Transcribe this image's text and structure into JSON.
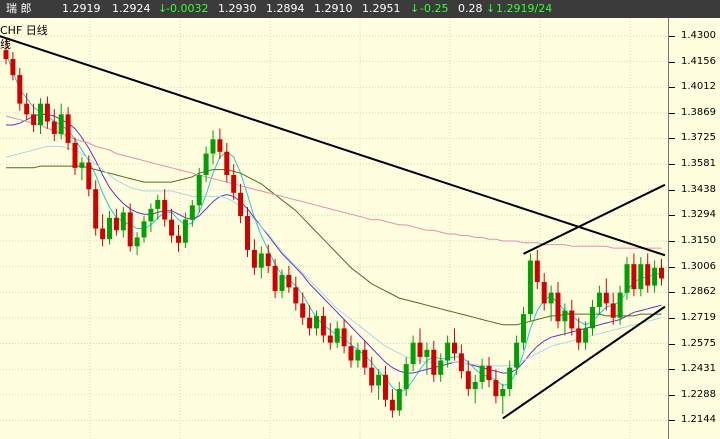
{
  "header": {
    "symbol": "瑞  郎",
    "last": "1.2919",
    "ask": "1.2924",
    "change": "-0.0032",
    "open": "1.2930",
    "low": "1.2894",
    "prev": "1.2910",
    "high": "1.2951",
    "change_pct": "-0.25",
    "amplitude": "0.28",
    "bid_info": "1.2919/24"
  },
  "labels": {
    "line1": "CHF  日线",
    "line2": "线"
  },
  "colors": {
    "bg": "#FFFFE0",
    "candle_up": "#00A000",
    "candle_down": "#D00000",
    "grid": "#D8D8B8",
    "ma_cyan": "#22C6DD",
    "ma_purple": "#6A2CC8",
    "ma_olive": "#4F6B1E",
    "ma_pink": "#E58BB8",
    "ma_lightblue": "#A8D8E8",
    "trend": "#000000"
  },
  "chart_data": {
    "type": "candlestick",
    "title": "",
    "ylim": [
      1.204,
      1.44
    ],
    "y_ticks": [
      "1.4300",
      "1.4156",
      "1.4012",
      "1.3869",
      "1.3725",
      "1.3581",
      "1.3438",
      "1.3294",
      "1.3150",
      "1.3006",
      "1.2862",
      "1.2719",
      "1.2575",
      "1.2431",
      "1.2288",
      "1.2144"
    ],
    "candles": [
      [
        1.422,
        1.428,
        1.414,
        1.417
      ],
      [
        1.417,
        1.421,
        1.405,
        1.408
      ],
      [
        1.408,
        1.412,
        1.388,
        1.392
      ],
      [
        1.392,
        1.398,
        1.383,
        1.386
      ],
      [
        1.386,
        1.392,
        1.376,
        1.38
      ],
      [
        1.38,
        1.395,
        1.375,
        1.392
      ],
      [
        1.392,
        1.396,
        1.378,
        1.382
      ],
      [
        1.382,
        1.389,
        1.371,
        1.375
      ],
      [
        1.375,
        1.392,
        1.372,
        1.386
      ],
      [
        1.386,
        1.39,
        1.366,
        1.37
      ],
      [
        1.37,
        1.373,
        1.352,
        1.356
      ],
      [
        1.356,
        1.362,
        1.349,
        1.359
      ],
      [
        1.359,
        1.363,
        1.34,
        1.344
      ],
      [
        1.344,
        1.349,
        1.318,
        1.322
      ],
      [
        1.322,
        1.33,
        1.312,
        1.316
      ],
      [
        1.316,
        1.332,
        1.313,
        1.328
      ],
      [
        1.328,
        1.333,
        1.318,
        1.321
      ],
      [
        1.321,
        1.334,
        1.317,
        1.331
      ],
      [
        1.331,
        1.336,
        1.309,
        1.312
      ],
      [
        1.312,
        1.32,
        1.307,
        1.317
      ],
      [
        1.317,
        1.329,
        1.314,
        1.326
      ],
      [
        1.326,
        1.336,
        1.32,
        1.333
      ],
      [
        1.333,
        1.341,
        1.327,
        1.338
      ],
      [
        1.338,
        1.344,
        1.323,
        1.327
      ],
      [
        1.327,
        1.333,
        1.314,
        1.318
      ],
      [
        1.318,
        1.324,
        1.309,
        1.314
      ],
      [
        1.314,
        1.331,
        1.311,
        1.327
      ],
      [
        1.327,
        1.338,
        1.323,
        1.335
      ],
      [
        1.335,
        1.356,
        1.331,
        1.352
      ],
      [
        1.352,
        1.368,
        1.348,
        1.364
      ],
      [
        1.364,
        1.377,
        1.358,
        1.372
      ],
      [
        1.372,
        1.378,
        1.361,
        1.365
      ],
      [
        1.365,
        1.37,
        1.348,
        1.352
      ],
      [
        1.352,
        1.358,
        1.338,
        1.342
      ],
      [
        1.342,
        1.347,
        1.325,
        1.329
      ],
      [
        1.329,
        1.334,
        1.306,
        1.31
      ],
      [
        1.31,
        1.316,
        1.296,
        1.3
      ],
      [
        1.3,
        1.312,
        1.294,
        1.308
      ],
      [
        1.308,
        1.313,
        1.297,
        1.301
      ],
      [
        1.301,
        1.305,
        1.283,
        1.287
      ],
      [
        1.287,
        1.299,
        1.283,
        1.296
      ],
      [
        1.296,
        1.301,
        1.286,
        1.289
      ],
      [
        1.289,
        1.295,
        1.276,
        1.28
      ],
      [
        1.28,
        1.286,
        1.268,
        1.272
      ],
      [
        1.272,
        1.279,
        1.262,
        1.266
      ],
      [
        1.266,
        1.276,
        1.262,
        1.273
      ],
      [
        1.273,
        1.278,
        1.258,
        1.262
      ],
      [
        1.262,
        1.269,
        1.254,
        1.258
      ],
      [
        1.258,
        1.27,
        1.255,
        1.266
      ],
      [
        1.266,
        1.271,
        1.252,
        1.256
      ],
      [
        1.256,
        1.262,
        1.244,
        1.248
      ],
      [
        1.248,
        1.258,
        1.244,
        1.254
      ],
      [
        1.254,
        1.259,
        1.24,
        1.244
      ],
      [
        1.244,
        1.25,
        1.23,
        1.234
      ],
      [
        1.234,
        1.243,
        1.226,
        1.24
      ],
      [
        1.24,
        1.245,
        1.222,
        1.226
      ],
      [
        1.226,
        1.232,
        1.216,
        1.22
      ],
      [
        1.22,
        1.236,
        1.217,
        1.232
      ],
      [
        1.232,
        1.25,
        1.228,
        1.246
      ],
      [
        1.246,
        1.262,
        1.242,
        1.258
      ],
      [
        1.258,
        1.266,
        1.246,
        1.25
      ],
      [
        1.25,
        1.258,
        1.24,
        1.254
      ],
      [
        1.254,
        1.259,
        1.236,
        1.24
      ],
      [
        1.24,
        1.252,
        1.236,
        1.248
      ],
      [
        1.248,
        1.262,
        1.244,
        1.258
      ],
      [
        1.258,
        1.266,
        1.248,
        1.252
      ],
      [
        1.252,
        1.257,
        1.238,
        1.242
      ],
      [
        1.242,
        1.248,
        1.228,
        1.232
      ],
      [
        1.232,
        1.24,
        1.224,
        1.236
      ],
      [
        1.236,
        1.249,
        1.232,
        1.245
      ],
      [
        1.245,
        1.25,
        1.233,
        1.237
      ],
      [
        1.237,
        1.243,
        1.224,
        1.228
      ],
      [
        1.228,
        1.235,
        1.218,
        1.232
      ],
      [
        1.232,
        1.248,
        1.228,
        1.244
      ],
      [
        1.244,
        1.262,
        1.24,
        1.258
      ],
      [
        1.258,
        1.278,
        1.254,
        1.274
      ],
      [
        1.274,
        1.308,
        1.27,
        1.304
      ],
      [
        1.304,
        1.31,
        1.288,
        1.292
      ],
      [
        1.292,
        1.297,
        1.276,
        1.28
      ],
      [
        1.28,
        1.29,
        1.27,
        1.286
      ],
      [
        1.286,
        1.292,
        1.266,
        1.27
      ],
      [
        1.27,
        1.28,
        1.262,
        1.276
      ],
      [
        1.276,
        1.282,
        1.262,
        1.266
      ],
      [
        1.266,
        1.272,
        1.254,
        1.258
      ],
      [
        1.258,
        1.27,
        1.254,
        1.266
      ],
      [
        1.266,
        1.282,
        1.262,
        1.278
      ],
      [
        1.278,
        1.29,
        1.274,
        1.286
      ],
      [
        1.286,
        1.294,
        1.276,
        1.28
      ],
      [
        1.28,
        1.286,
        1.268,
        1.272
      ],
      [
        1.272,
        1.29,
        1.268,
        1.286
      ],
      [
        1.286,
        1.306,
        1.282,
        1.302
      ],
      [
        1.302,
        1.308,
        1.284,
        1.288
      ],
      [
        1.288,
        1.306,
        1.284,
        1.302
      ],
      [
        1.302,
        1.308,
        1.286,
        1.29
      ],
      [
        1.29,
        1.304,
        1.286,
        1.3
      ],
      [
        1.3,
        1.305,
        1.29,
        1.294
      ]
    ],
    "ma_series": [
      {
        "color_key": "ma_cyan",
        "values": [
          1.42,
          1.41,
          1.4,
          1.395,
          1.39,
          1.387,
          1.385,
          1.382,
          1.38,
          1.377,
          1.372,
          1.366,
          1.36,
          1.352,
          1.342,
          1.334,
          1.328,
          1.326,
          1.324,
          1.322,
          1.322,
          1.324,
          1.328,
          1.331,
          1.331,
          1.327,
          1.324,
          1.325,
          1.331,
          1.341,
          1.353,
          1.362,
          1.365,
          1.362,
          1.353,
          1.341,
          1.328,
          1.318,
          1.31,
          1.302,
          1.296,
          1.293,
          1.29,
          1.285,
          1.278,
          1.272,
          1.268,
          1.265,
          1.262,
          1.26,
          1.257,
          1.254,
          1.251,
          1.247,
          1.242,
          1.238,
          1.233,
          1.23,
          1.232,
          1.237,
          1.243,
          1.248,
          1.25,
          1.249,
          1.249,
          1.25,
          1.25,
          1.247,
          1.243,
          1.24,
          1.239,
          1.237,
          1.234,
          1.235,
          1.242,
          1.252,
          1.266,
          1.276,
          1.282,
          1.284,
          1.28,
          1.276,
          1.273,
          1.27,
          1.268,
          1.27,
          1.274,
          1.278,
          1.279,
          1.281,
          1.287,
          1.292,
          1.294,
          1.295,
          1.296,
          1.297
        ]
      },
      {
        "color_key": "ma_purple",
        "values": [
          1.38,
          1.38,
          1.381,
          1.383,
          1.385,
          1.386,
          1.386,
          1.385,
          1.383,
          1.381,
          1.378,
          1.373,
          1.367,
          1.36,
          1.352,
          1.345,
          1.34,
          1.336,
          1.333,
          1.331,
          1.33,
          1.33,
          1.331,
          1.332,
          1.332,
          1.33,
          1.328,
          1.327,
          1.329,
          1.333,
          1.337,
          1.34,
          1.341,
          1.34,
          1.337,
          1.333,
          1.328,
          1.323,
          1.318,
          1.313,
          1.308,
          1.304,
          1.3,
          1.296,
          1.291,
          1.287,
          1.283,
          1.279,
          1.275,
          1.271,
          1.267,
          1.263,
          1.259,
          1.255,
          1.251,
          1.247,
          1.244,
          1.242,
          1.241,
          1.241,
          1.242,
          1.243,
          1.244,
          1.245,
          1.246,
          1.247,
          1.247,
          1.246,
          1.245,
          1.244,
          1.243,
          1.242,
          1.241,
          1.241,
          1.243,
          1.247,
          1.252,
          1.256,
          1.259,
          1.261,
          1.262,
          1.263,
          1.264,
          1.265,
          1.266,
          1.267,
          1.268,
          1.269,
          1.27,
          1.271,
          1.273,
          1.275,
          1.276,
          1.277,
          1.278,
          1.279
        ]
      },
      {
        "color_key": "ma_olive",
        "values": [
          1.356,
          1.356,
          1.356,
          1.356,
          1.356,
          1.357,
          1.357,
          1.357,
          1.357,
          1.357,
          1.357,
          1.357,
          1.356,
          1.355,
          1.354,
          1.353,
          1.352,
          1.351,
          1.35,
          1.349,
          1.348,
          1.348,
          1.348,
          1.348,
          1.348,
          1.349,
          1.35,
          1.351,
          1.353,
          1.354,
          1.355,
          1.355,
          1.355,
          1.354,
          1.353,
          1.351,
          1.349,
          1.347,
          1.344,
          1.341,
          1.338,
          1.335,
          1.332,
          1.328,
          1.324,
          1.32,
          1.316,
          1.312,
          1.308,
          1.304,
          1.3,
          1.297,
          1.294,
          1.291,
          1.289,
          1.287,
          1.285,
          1.283,
          1.282,
          1.281,
          1.28,
          1.279,
          1.278,
          1.277,
          1.276,
          1.275,
          1.274,
          1.273,
          1.272,
          1.271,
          1.27,
          1.269,
          1.268,
          1.268,
          1.268,
          1.269,
          1.27,
          1.271,
          1.272,
          1.273,
          1.273,
          1.274,
          1.274,
          1.274,
          1.274,
          1.274,
          1.274,
          1.273,
          1.273,
          1.273,
          1.273,
          1.273,
          1.274,
          1.274,
          1.274,
          1.274
        ]
      },
      {
        "color_key": "ma_pink",
        "values": [
          1.385,
          1.384,
          1.383,
          1.382,
          1.381,
          1.38,
          1.378,
          1.377,
          1.375,
          1.374,
          1.372,
          1.371,
          1.37,
          1.368,
          1.367,
          1.366,
          1.364,
          1.363,
          1.362,
          1.361,
          1.36,
          1.359,
          1.358,
          1.357,
          1.356,
          1.355,
          1.354,
          1.353,
          1.352,
          1.351,
          1.35,
          1.349,
          1.348,
          1.347,
          1.346,
          1.345,
          1.344,
          1.343,
          1.342,
          1.341,
          1.34,
          1.339,
          1.338,
          1.337,
          1.336,
          1.335,
          1.334,
          1.333,
          1.332,
          1.331,
          1.33,
          1.329,
          1.328,
          1.327,
          1.327,
          1.326,
          1.325,
          1.324,
          1.324,
          1.323,
          1.322,
          1.321,
          1.321,
          1.32,
          1.319,
          1.319,
          1.318,
          1.318,
          1.317,
          1.317,
          1.316,
          1.316,
          1.315,
          1.315,
          1.315,
          1.314,
          1.314,
          1.314,
          1.313,
          1.313,
          1.313,
          1.313,
          1.312,
          1.312,
          1.312,
          1.312,
          1.312,
          1.312,
          1.311,
          1.311,
          1.311,
          1.311,
          1.311,
          1.311,
          1.311,
          1.311
        ]
      },
      {
        "color_key": "ma_lightblue",
        "values": [
          1.362,
          1.363,
          1.364,
          1.365,
          1.366,
          1.367,
          1.368,
          1.368,
          1.368,
          1.367,
          1.366,
          1.364,
          1.361,
          1.358,
          1.355,
          1.352,
          1.349,
          1.347,
          1.345,
          1.344,
          1.343,
          1.343,
          1.343,
          1.343,
          1.343,
          1.342,
          1.341,
          1.34,
          1.34,
          1.34,
          1.34,
          1.34,
          1.339,
          1.337,
          1.334,
          1.331,
          1.327,
          1.323,
          1.319,
          1.314,
          1.309,
          1.305,
          1.301,
          1.297,
          1.293,
          1.289,
          1.285,
          1.281,
          1.277,
          1.274,
          1.271,
          1.268,
          1.265,
          1.262,
          1.259,
          1.256,
          1.254,
          1.252,
          1.25,
          1.249,
          1.248,
          1.247,
          1.247,
          1.247,
          1.247,
          1.247,
          1.247,
          1.246,
          1.246,
          1.245,
          1.245,
          1.245,
          1.245,
          1.245,
          1.246,
          1.248,
          1.25,
          1.252,
          1.254,
          1.256,
          1.257,
          1.258,
          1.259,
          1.26,
          1.261,
          1.262,
          1.263,
          1.264,
          1.265,
          1.266,
          1.267,
          1.268,
          1.269,
          1.27,
          1.271,
          1.272
        ]
      }
    ],
    "trendlines": [
      {
        "from_index": -1,
        "from_value": 1.43,
        "to_index": 95.5,
        "to_value": 1.307
      },
      {
        "from_index": 72,
        "from_value": 1.2155,
        "to_index": 95.5,
        "to_value": 1.2782
      },
      {
        "from_index": 75,
        "from_value": 1.3078,
        "to_index": 95.5,
        "to_value": 1.3465
      }
    ]
  }
}
